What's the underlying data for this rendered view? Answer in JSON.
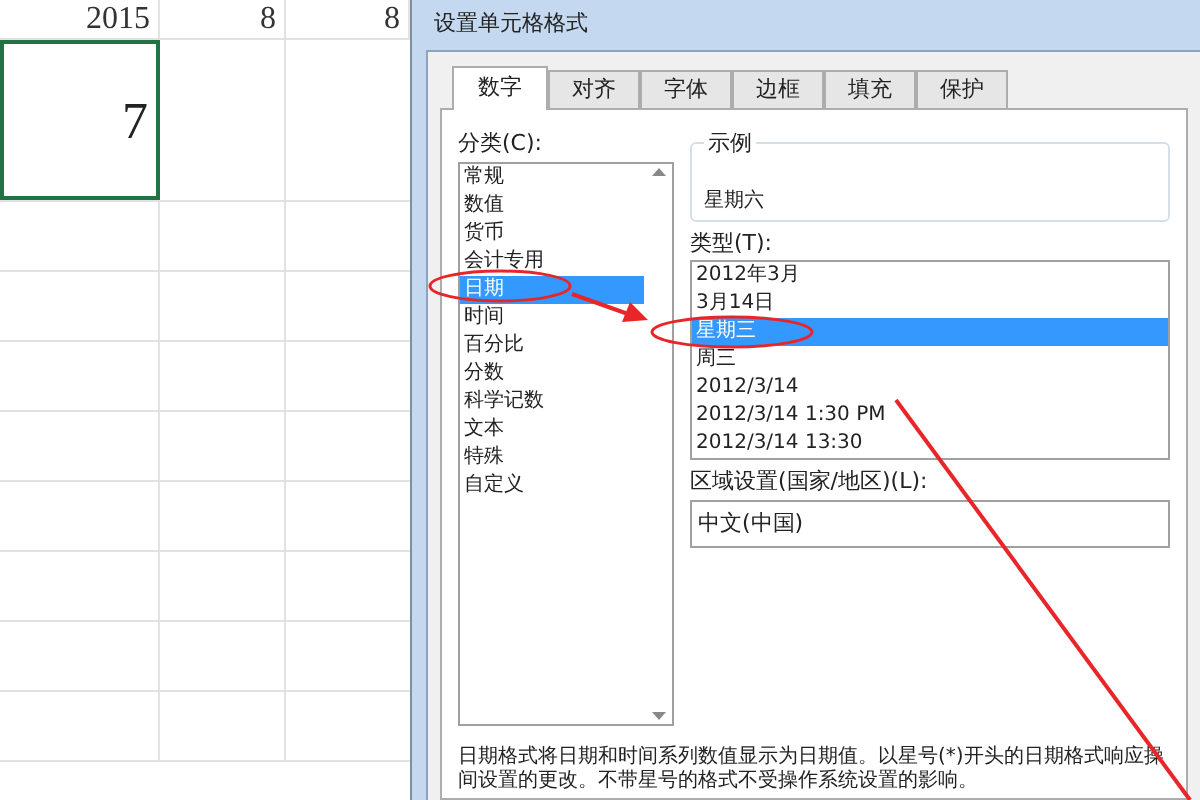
{
  "spreadsheet": {
    "header_row": [
      "2015",
      "8",
      "8"
    ],
    "active_cell": "7"
  },
  "dialog": {
    "title": "设置单元格格式",
    "tabs": [
      {
        "label": "数字",
        "selected": true
      },
      {
        "label": "对齐",
        "selected": false
      },
      {
        "label": "字体",
        "selected": false
      },
      {
        "label": "边框",
        "selected": false
      },
      {
        "label": "填充",
        "selected": false
      },
      {
        "label": "保护",
        "selected": false
      }
    ],
    "category_label": "分类(C):",
    "categories": [
      {
        "label": "常规",
        "selected": false
      },
      {
        "label": "数值",
        "selected": false
      },
      {
        "label": "货币",
        "selected": false
      },
      {
        "label": "会计专用",
        "selected": false
      },
      {
        "label": "日期",
        "selected": true
      },
      {
        "label": "时间",
        "selected": false
      },
      {
        "label": "百分比",
        "selected": false
      },
      {
        "label": "分数",
        "selected": false
      },
      {
        "label": "科学记数",
        "selected": false
      },
      {
        "label": "文本",
        "selected": false
      },
      {
        "label": "特殊",
        "selected": false
      },
      {
        "label": "自定义",
        "selected": false
      }
    ],
    "sample_label": "示例",
    "sample_value": "星期六",
    "type_label": "类型(T):",
    "types": [
      {
        "label": "2012年3月",
        "selected": false
      },
      {
        "label": "3月14日",
        "selected": false
      },
      {
        "label": "星期三",
        "selected": true
      },
      {
        "label": "周三",
        "selected": false
      },
      {
        "label": "2012/3/14",
        "selected": false
      },
      {
        "label": "2012/3/14 1:30 PM",
        "selected": false
      },
      {
        "label": "2012/3/14 13:30",
        "selected": false
      }
    ],
    "locale_label": "区域设置(国家/地区)(L):",
    "locale_value": "中文(中国)",
    "description": [
      "日期格式将日期和时间系列数值显示为日期值。以星号(*)开头的日期格式响应操",
      "间设置的更改。不带星号的格式不受操作系统设置的影响。"
    ]
  }
}
